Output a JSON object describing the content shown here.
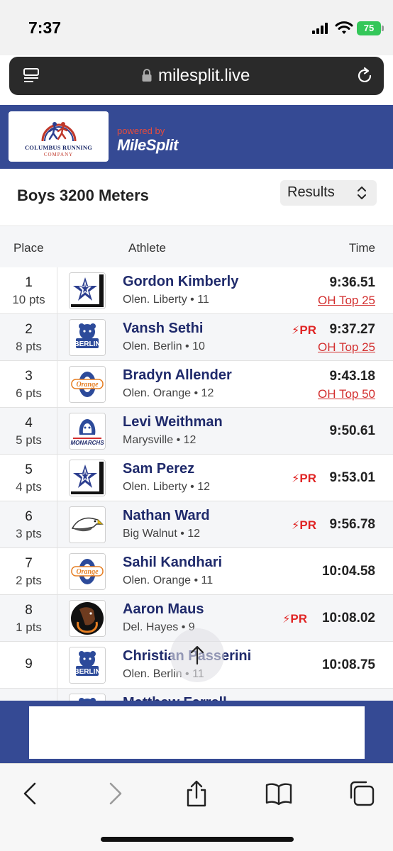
{
  "status_bar": {
    "time": "7:37",
    "battery": "75"
  },
  "browser": {
    "url": "milesplit.live"
  },
  "header": {
    "sponsor_name": "COLUMBUS RUNNING",
    "sponsor_sub": "COMPANY",
    "powered_by": "powered by",
    "brand": "MileSplit"
  },
  "event": {
    "title": "Boys 3200 Meters",
    "view_select": "Results"
  },
  "table": {
    "headers": {
      "place": "Place",
      "athlete": "Athlete",
      "time": "Time"
    },
    "rows": [
      {
        "place": "1",
        "points": "10 pts",
        "name": "Gordon Kimberly",
        "team_grade": "Olen. Liberty • 11",
        "time": "9:36.51",
        "pr": "",
        "rank_link": "OH Top 25",
        "logo": "liberty"
      },
      {
        "place": "2",
        "points": "8 pts",
        "name": "Vansh Sethi",
        "team_grade": "Olen. Berlin • 10",
        "time": "9:37.27",
        "pr": "PR",
        "rank_link": "OH Top 25",
        "logo": "berlin"
      },
      {
        "place": "3",
        "points": "6 pts",
        "name": "Bradyn Allender",
        "team_grade": "Olen. Orange • 12",
        "time": "9:43.18",
        "pr": "",
        "rank_link": "OH Top 50",
        "logo": "orange"
      },
      {
        "place": "4",
        "points": "5 pts",
        "name": "Levi Weithman",
        "team_grade": "Marysville • 12",
        "time": "9:50.61",
        "pr": "",
        "rank_link": "",
        "logo": "monarchs"
      },
      {
        "place": "5",
        "points": "4 pts",
        "name": "Sam Perez",
        "team_grade": "Olen. Liberty • 12",
        "time": "9:53.01",
        "pr": "PR",
        "rank_link": "",
        "logo": "liberty"
      },
      {
        "place": "6",
        "points": "3 pts",
        "name": "Nathan Ward",
        "team_grade": "Big Walnut • 12",
        "time": "9:56.78",
        "pr": "PR",
        "rank_link": "",
        "logo": "eagle"
      },
      {
        "place": "7",
        "points": "2 pts",
        "name": "Sahil Kandhari",
        "team_grade": "Olen. Orange • 11",
        "time": "10:04.58",
        "pr": "",
        "rank_link": "",
        "logo": "orange"
      },
      {
        "place": "8",
        "points": "1 pts",
        "name": "Aaron Maus",
        "team_grade": "Del. Hayes • 9",
        "time": "10:08.02",
        "pr": "PR",
        "rank_link": "",
        "logo": "hayes"
      },
      {
        "place": "9",
        "points": "",
        "name": "Christian Passerini",
        "team_grade": "Olen. Berlin • 11",
        "time": "10:08.75",
        "pr": "",
        "rank_link": "",
        "logo": "berlin"
      },
      {
        "place": "",
        "points": "",
        "name": "Matthew Farrell",
        "team_grade": "",
        "time": "",
        "pr": "",
        "rank_link": "",
        "logo": "berlin"
      }
    ]
  },
  "colors": {
    "brand_blue": "#354a94",
    "name_navy": "#1f2a6b",
    "pr_red": "#e02424",
    "link_red": "#d32f2f"
  }
}
